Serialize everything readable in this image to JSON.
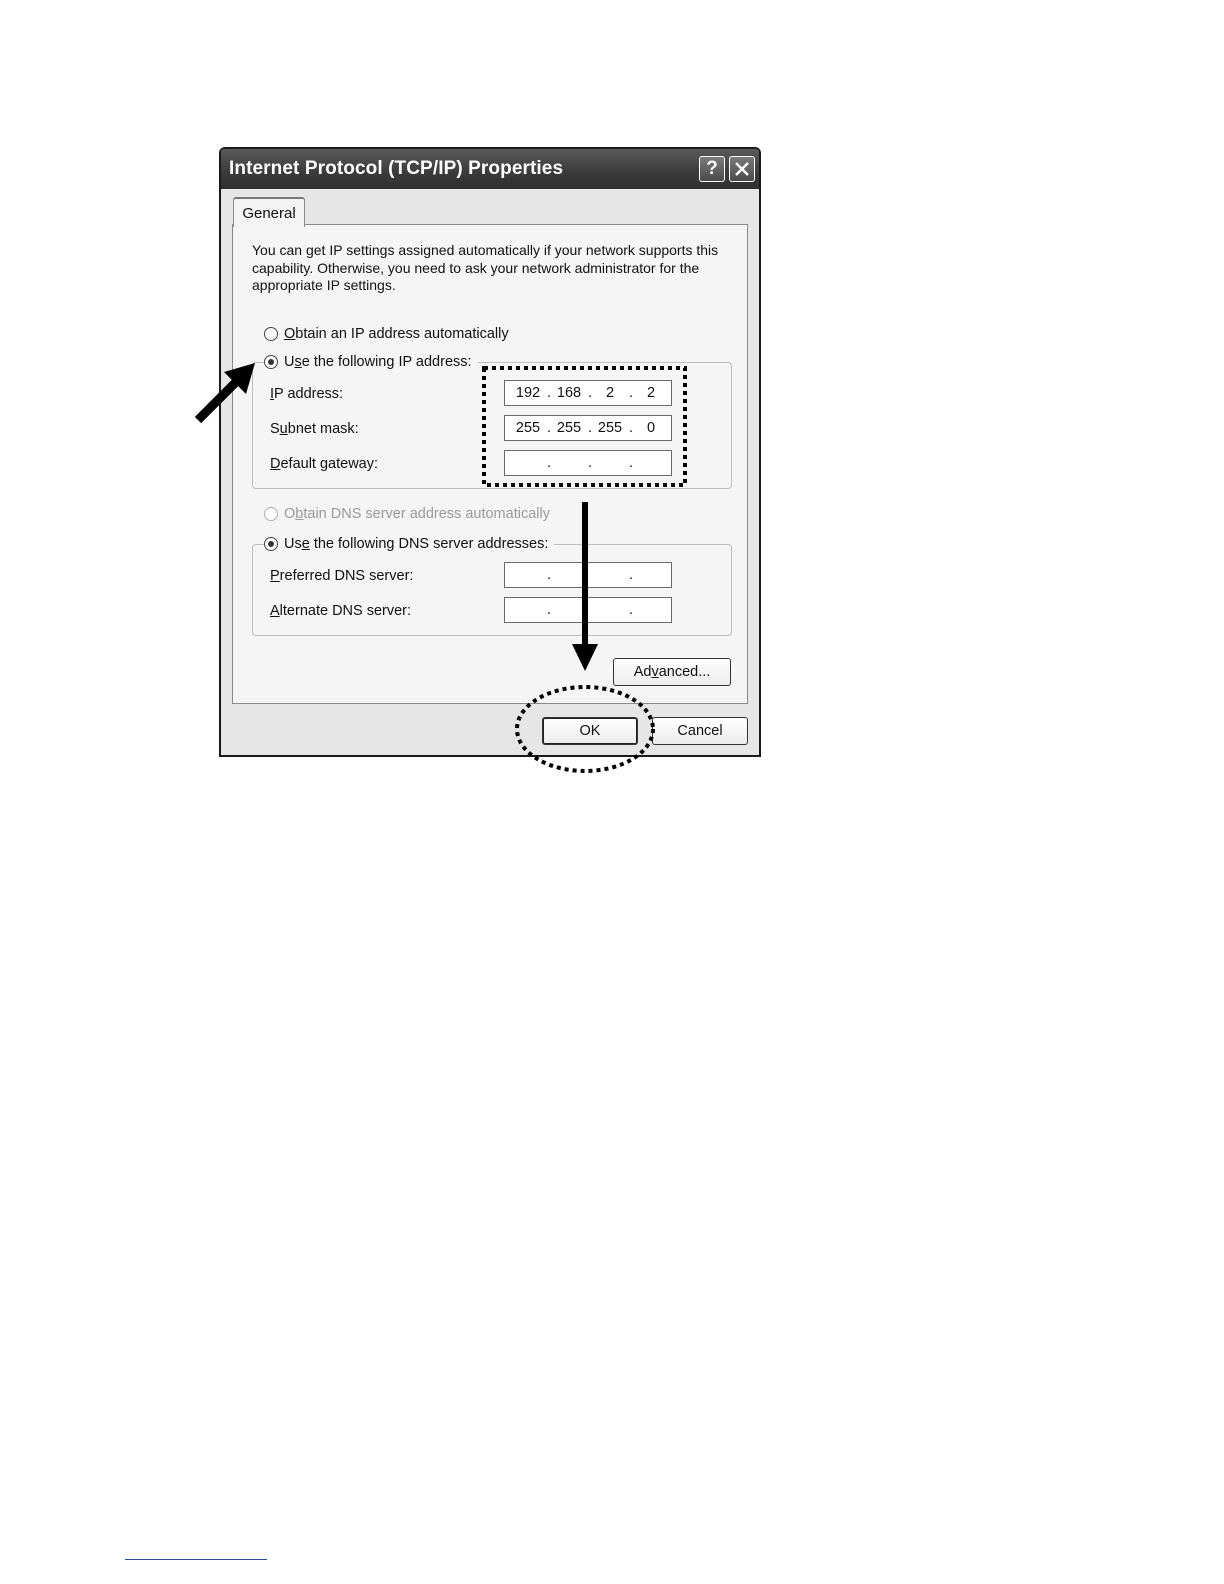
{
  "dialog": {
    "title": "Internet Protocol (TCP/IP) Properties",
    "help_label": "?",
    "close_label": "✕"
  },
  "tabs": [
    {
      "label": "General"
    }
  ],
  "description": "You can get IP settings assigned automatically if your network supports this capability. Otherwise, you need to ask your network administrator for the appropriate IP settings.",
  "ip_mode": {
    "auto_pre": "",
    "auto_key": "O",
    "auto_post": "btain an IP address automatically",
    "manual_pre": "U",
    "manual_key": "s",
    "manual_post": "e the following IP address:",
    "selected": "manual"
  },
  "ip_fields": {
    "ip_label_key": "I",
    "ip_label_rest": "P address:",
    "ip_octets": [
      "192",
      "168",
      "2",
      "2"
    ],
    "subnet_label_pre": "S",
    "subnet_label_key": "u",
    "subnet_label_post": "bnet mask:",
    "subnet_octets": [
      "255",
      "255",
      "255",
      "0"
    ],
    "gateway_label_key": "D",
    "gateway_label_rest": "efault gateway:",
    "gateway_octets": [
      "",
      "",
      "",
      ""
    ]
  },
  "dns_mode": {
    "auto_pre": "O",
    "auto_key": "b",
    "auto_post": "tain DNS server address automatically",
    "manual_pre": "Us",
    "manual_key": "e",
    "manual_post": " the following DNS server addresses:",
    "selected": "manual"
  },
  "dns_fields": {
    "preferred_key": "P",
    "preferred_rest": "referred DNS server:",
    "preferred_octets": [
      "",
      "",
      "",
      ""
    ],
    "alternate_key": "A",
    "alternate_rest": "lternate DNS server:",
    "alternate_octets": [
      "",
      "",
      "",
      ""
    ]
  },
  "buttons": {
    "advanced_pre": "Ad",
    "advanced_key": "v",
    "advanced_post": "anced...",
    "ok": "OK",
    "cancel": "Cancel"
  },
  "separator": ".",
  "colors": {
    "title_bar": "#3a3a3a",
    "dialog_bg": "#e6e6e6",
    "annotation": "#000000"
  }
}
